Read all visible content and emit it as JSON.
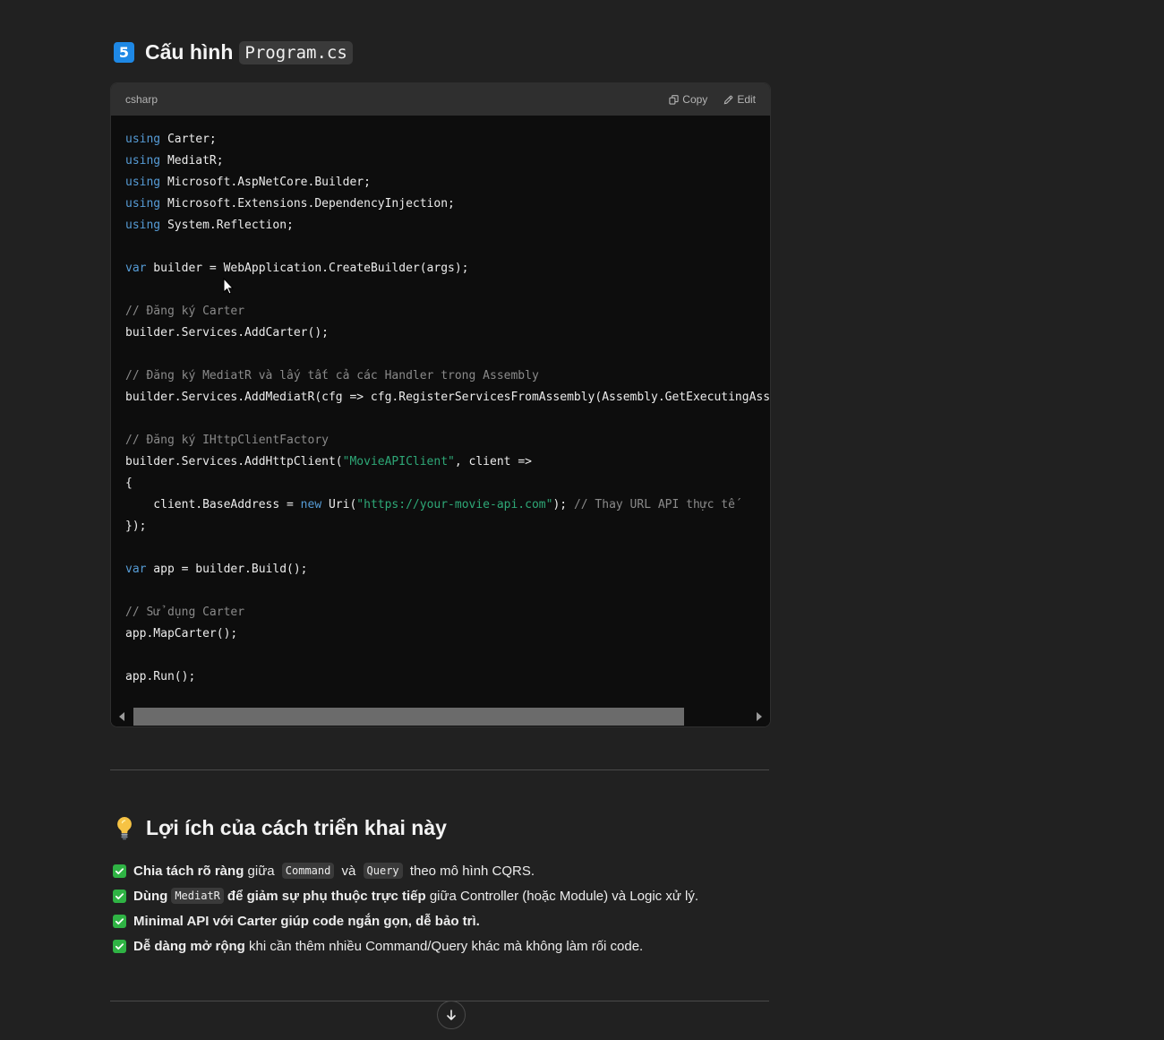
{
  "section5": {
    "badge": "5",
    "title": "Cấu hình",
    "code_title": "Program.cs"
  },
  "code_block": {
    "language": "csharp",
    "copy_label": "Copy",
    "edit_label": "Edit",
    "lines": {
      "l1": {
        "kw": "using",
        "rest": " Carter;"
      },
      "l2": {
        "kw": "using",
        "rest": " MediatR;"
      },
      "l3": {
        "kw": "using",
        "rest": " Microsoft.AspNetCore.Builder;"
      },
      "l4": {
        "kw": "using",
        "rest": " Microsoft.Extensions.DependencyInjection;"
      },
      "l5": {
        "kw": "using",
        "rest": " System.Reflection;"
      },
      "l7": {
        "kw": "var",
        "rest": " builder = WebApplication.CreateBuilder(args);"
      },
      "l9": {
        "comment": "// Đăng ký Carter"
      },
      "l10": {
        "text": "builder.Services.AddCarter();"
      },
      "l12": {
        "comment": "// Đăng ký MediatR và lấy tất cả các Handler trong Assembly"
      },
      "l13": {
        "text": "builder.Services.AddMediatR(cfg => cfg.RegisterServicesFromAssembly(Assembly.GetExecutingAssembly()));"
      },
      "l15": {
        "comment": "// Đăng ký IHttpClientFactory"
      },
      "l16": {
        "pre": "builder.Services.AddHttpClient(",
        "str": "\"MovieAPIClient\"",
        "post": ", client =>"
      },
      "l17": {
        "text": "{"
      },
      "l18": {
        "pre": "    client.BaseAddress = ",
        "kw": "new",
        "mid": " Uri(",
        "str": "\"https://your-movie-api.com\"",
        "post": "); ",
        "comment": "// Thay URL API thực tế"
      },
      "l19": {
        "text": "});"
      },
      "l21": {
        "kw": "var",
        "rest": " app = builder.Build();"
      },
      "l23": {
        "comment": "// Sử dụng Carter"
      },
      "l24": {
        "text": "app.MapCarter();"
      },
      "l26": {
        "text": "app.Run();"
      }
    }
  },
  "benefits": {
    "title": "Lợi ích của cách triển khai này",
    "items": [
      {
        "bold": "Chia tách rõ ràng",
        "t1": " giữa ",
        "c1": "Command",
        "t2": " và ",
        "c2": "Query",
        "t3": " theo mô hình CQRS."
      },
      {
        "bold": "Dùng",
        "c1": "MediatR",
        "bold2": "để giảm sự phụ thuộc trực tiếp",
        "t1": " giữa Controller (hoặc Module) và Logic xử lý."
      },
      {
        "bold": "Minimal API với Carter giúp code ngắn gọn, dễ bảo trì."
      },
      {
        "bold": "Dễ dàng mở rộng",
        "t1": " khi cần thêm nhiều Command/Query khác mà không làm rối code."
      }
    ]
  }
}
